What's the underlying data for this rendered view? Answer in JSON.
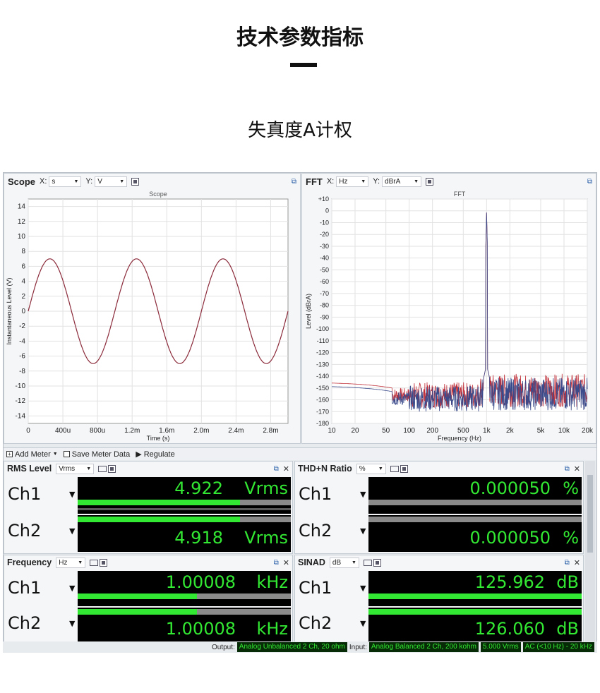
{
  "header": {
    "title": "技术参数指标",
    "subtitle": "失真度A计权"
  },
  "scope": {
    "panel_title": "Scope",
    "x_label": "X:",
    "x_unit": "s",
    "y_label": "Y:",
    "y_unit": "V",
    "chart_title": "Scope",
    "xlabel": "Time (s)",
    "ylabel": "Instantaneous Level (V)",
    "y_ticks": [
      "14",
      "12",
      "10",
      "8",
      "6",
      "4",
      "2",
      "0",
      "-2",
      "-4",
      "-6",
      "-8",
      "-10",
      "-12",
      "-14"
    ],
    "x_ticks": [
      "0",
      "400u",
      "800u",
      "1.2m",
      "1.6m",
      "2.0m",
      "2.4m",
      "2.8m"
    ]
  },
  "fft": {
    "panel_title": "FFT",
    "x_label": "X:",
    "x_unit": "Hz",
    "y_label": "Y:",
    "y_unit": "dBrA",
    "chart_title": "FFT",
    "xlabel": "Frequency (Hz)",
    "ylabel": "Level (dBrA)",
    "y_ticks": [
      "+10",
      "0",
      "-10",
      "-20",
      "-30",
      "-40",
      "-50",
      "-60",
      "-70",
      "-80",
      "-90",
      "-100",
      "-110",
      "-120",
      "-130",
      "-140",
      "-150",
      "-160",
      "-170",
      "-180"
    ],
    "x_ticks": [
      "10",
      "20",
      "50",
      "100",
      "200",
      "500",
      "1k",
      "2k",
      "5k",
      "10k",
      "20k"
    ]
  },
  "chart_data": [
    {
      "type": "line",
      "title": "Scope",
      "xlabel": "Time (s)",
      "ylabel": "Instantaneous Level (V)",
      "xlim": [
        0,
        0.003
      ],
      "ylim": [
        -15,
        15
      ],
      "series": [
        {
          "frequency_hz": 1000.08,
          "amplitude_v": 7.0,
          "color": "#8b2a3a"
        }
      ]
    },
    {
      "type": "line",
      "title": "FFT",
      "xlabel": "Frequency (Hz)",
      "ylabel": "Level (dBrA)",
      "x_scale": "log",
      "xlim": [
        10,
        20000
      ],
      "ylim": [
        -180,
        10
      ],
      "series": [
        {
          "color": "#c0303a",
          "peak_hz": 1000,
          "peak_dbra": 0,
          "floor_dbra": -152
        },
        {
          "color": "#3a4a8a",
          "peak_hz": 1000,
          "peak_dbra": 0,
          "floor_dbra": -155
        }
      ]
    }
  ],
  "toolbar": {
    "add_meter": "Add Meter",
    "save_meter": "Save Meter Data",
    "regulate": "Regulate"
  },
  "meters": {
    "rms": {
      "title": "RMS Level",
      "unit_sel": "Vrms",
      "ch1": "Ch1",
      "ch2": "Ch2",
      "v1": "4.922",
      "v2": "4.918",
      "unit": "Vrms",
      "bar1": 0.76,
      "bar2": 0.76
    },
    "thd": {
      "title": "THD+N Ratio",
      "unit_sel": "%",
      "ch1": "Ch1",
      "ch2": "Ch2",
      "v1": "0.000050",
      "v2": "0.000050",
      "unit": "%",
      "bar1": 0.0,
      "bar2": 0.0
    },
    "freq": {
      "title": "Frequency",
      "unit_sel": "Hz",
      "ch1": "Ch1",
      "ch2": "Ch2",
      "v1": "1.00008",
      "v2": "1.00008",
      "unit": "kHz",
      "bar1": 0.56,
      "bar2": 0.56
    },
    "sinad": {
      "title": "SINAD",
      "unit_sel": "dB",
      "ch1": "Ch1",
      "ch2": "Ch2",
      "v1": "125.962",
      "v2": "126.060",
      "unit": "dB",
      "bar1": 1.0,
      "bar2": 1.0
    }
  },
  "status": {
    "output_label": "Output:",
    "output_val": "Analog Unbalanced 2 Ch, 20 ohm",
    "input_label": "Input:",
    "input_val": "Analog Balanced 2 Ch, 200 kohm",
    "level": "5.000 Vrms",
    "filter": "AC (<10 Hz) - 20 kHz"
  },
  "colors": {
    "lcd_green": "#33e833",
    "scope_trace": "#8b2a3a"
  }
}
